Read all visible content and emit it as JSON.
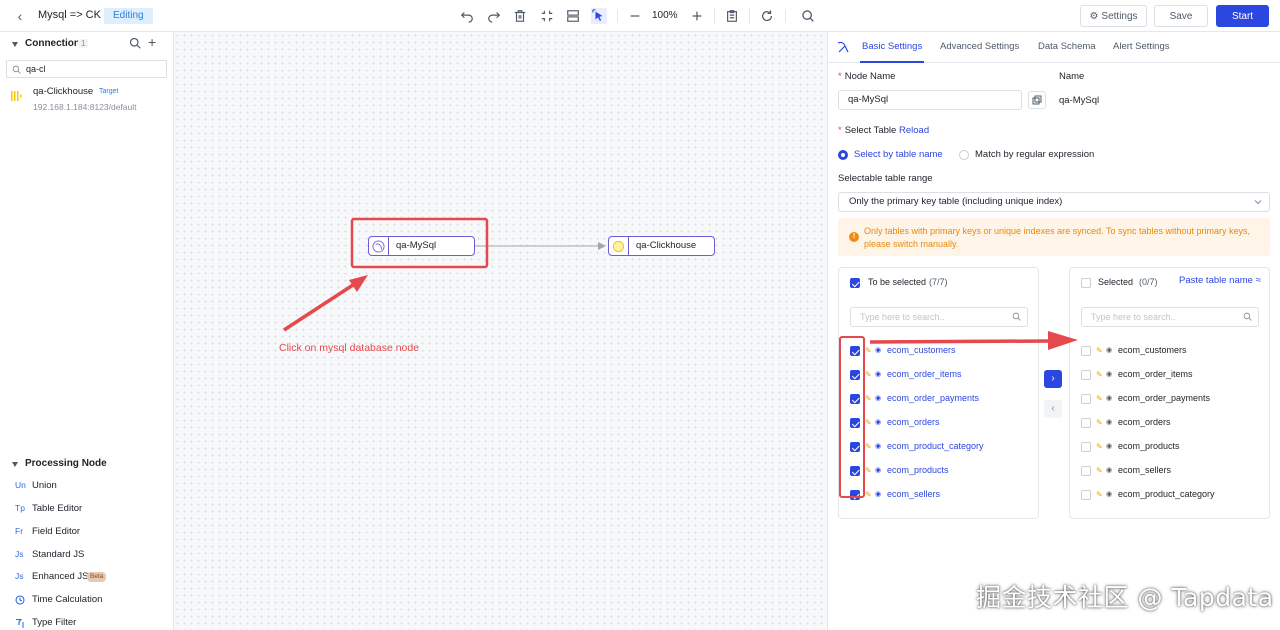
{
  "topbar": {
    "title": "Mysql => CK",
    "status": "Editing",
    "zoom": "100%",
    "settings_label": "Settings",
    "save_label": "Save",
    "start_label": "Start"
  },
  "left_panel": {
    "connection": {
      "heading": "Connection",
      "count": "1",
      "search_value": "qa-cl",
      "items": [
        {
          "name": "qa-Clickhouse",
          "tag": "Target",
          "host": "192.168.1.184:8123/default"
        }
      ]
    },
    "processing": {
      "heading": "Processing Node",
      "items": [
        {
          "abbr": "Un",
          "label": "Union",
          "badge": ""
        },
        {
          "abbr": "Tp",
          "label": "Table Editor",
          "badge": ""
        },
        {
          "abbr": "Fr",
          "label": "Field Editor",
          "badge": ""
        },
        {
          "abbr": "Js",
          "label": "Standard JS",
          "badge": ""
        },
        {
          "abbr": "Js",
          "label": "Enhanced JS",
          "badge": "Beta"
        },
        {
          "abbr": "",
          "label": "Time Calculation",
          "badge": ""
        },
        {
          "abbr": "",
          "label": "Type Filter",
          "badge": ""
        }
      ]
    }
  },
  "canvas": {
    "source_node": "qa-MySql",
    "target_node": "qa-Clickhouse",
    "annotation": "Click on mysql database node",
    "annotation_color": "#e5484d"
  },
  "right_panel": {
    "tabs": [
      "Basic Settings",
      "Advanced Settings",
      "Data Schema",
      "Alert Settings"
    ],
    "active_tab": "Basic Settings",
    "node_name_label": "Node Name",
    "node_name_value": "qa-MySql",
    "name_label": "Name",
    "name_value": "qa-MySql",
    "select_table_label": "Select Table",
    "reload_label": "Reload",
    "radio_by_name": "Select by table name",
    "radio_by_regex": "Match by regular expression",
    "range_label": "Selectable table range",
    "range_value": "Only the primary key table (including unique index)",
    "warning": "Only tables with primary keys or unique indexes are synced. To sync tables without primary keys, please switch manually.",
    "to_select": {
      "title": "To be selected",
      "count": "(7/7)",
      "search_placeholder": "Type here to search..",
      "tables": [
        "ecom_customers",
        "ecom_order_items",
        "ecom_order_payments",
        "ecom_orders",
        "ecom_product_category",
        "ecom_products",
        "ecom_sellers"
      ]
    },
    "selected": {
      "title": "Selected",
      "count": "(0/7)",
      "paste_label": "Paste table name",
      "search_placeholder": "Type here to search..",
      "tables": [
        "ecom_customers",
        "ecom_order_items",
        "ecom_order_payments",
        "ecom_orders",
        "ecom_products",
        "ecom_sellers",
        "ecom_product_category"
      ]
    }
  },
  "colors": {
    "accent": "#2c46e0",
    "annotation": "#e5484d",
    "warning": "#e8890c"
  },
  "watermark": "掘金技术社区 @ Tapdata"
}
